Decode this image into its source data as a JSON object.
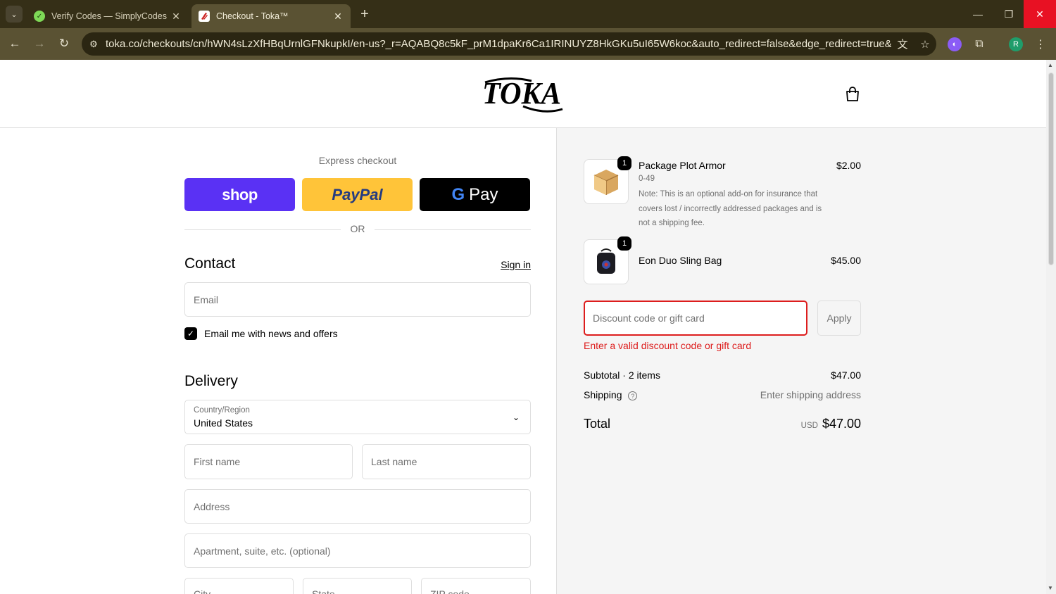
{
  "browser": {
    "tabs": [
      {
        "title": "Verify Codes — SimplyCodes",
        "favicon": "simplycodes-icon"
      },
      {
        "title": "Checkout - Toka™",
        "favicon": "toka-icon"
      }
    ],
    "url": "toka.co/checkouts/cn/hWN4sLzXfHBqUrnlGFNkupkI/en-us?_r=AQABQ8c5kF_prM1dpaKr6Ca1IRINUYZ8HkGKu5uI65W6koc&auto_redirect=false&edge_redirect=true&skip_shop_pay...",
    "profile_initial": "R",
    "colors": {
      "frame": "#352f17",
      "toolbar": "#5a5233",
      "close": "#e81123"
    }
  },
  "header": {
    "logo_text": "TOKA"
  },
  "express": {
    "title": "Express checkout",
    "shop_label": "shop",
    "paypal_label": "PayPal",
    "gpay_label": "Pay",
    "or_label": "OR"
  },
  "contact": {
    "heading": "Contact",
    "signin_label": "Sign in",
    "email_placeholder": "Email",
    "newsletter_label": "Email me with news and offers",
    "newsletter_checked": true
  },
  "delivery": {
    "heading": "Delivery",
    "country_label": "Country/Region",
    "country_value": "United States",
    "first_name_placeholder": "First name",
    "last_name_placeholder": "Last name",
    "address_placeholder": "Address",
    "apartment_placeholder": "Apartment, suite, etc. (optional)",
    "city_placeholder": "City",
    "state_placeholder": "State",
    "zip_placeholder": "ZIP code"
  },
  "order": {
    "items": [
      {
        "name": "Package Plot Armor",
        "variant": "0-49",
        "note": "Note: This is an optional add-on for insurance that covers lost / incorrectly addressed packages and is not a shipping fee.",
        "price": "$2.00",
        "quantity": "1"
      },
      {
        "name": "Eon Duo Sling Bag",
        "price": "$45.00",
        "quantity": "1"
      }
    ],
    "discount_placeholder": "Discount code or gift card",
    "apply_label": "Apply",
    "discount_error": "Enter a valid discount code or gift card",
    "subtotal_label": "Subtotal · 2 items",
    "subtotal_value": "$47.00",
    "shipping_label": "Shipping",
    "shipping_value": "Enter shipping address",
    "total_label": "Total",
    "total_currency": "USD",
    "total_value": "$47.00",
    "colors": {
      "error": "#dd1d1d",
      "shop_pay": "#5a31f4",
      "paypal": "#ffc439"
    }
  }
}
